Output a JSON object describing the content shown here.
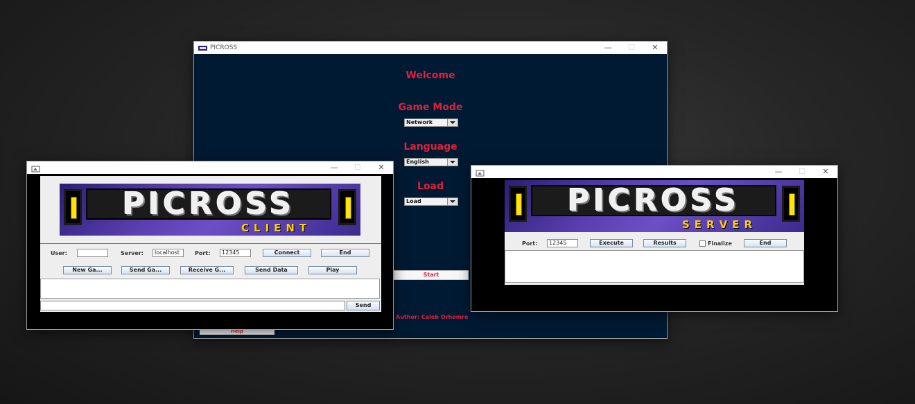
{
  "main_window": {
    "title": "PICROSS",
    "welcome": "Welcome",
    "game_mode_label": "Game Mode",
    "game_mode_value": "Network",
    "language_label": "Language",
    "language_value": "English",
    "load_label": "Load",
    "load_value": "Load",
    "start_label": "Start",
    "help_label": "Help",
    "author": "Author: Caleb Orhomre"
  },
  "client_window": {
    "banner_title": "PICROSS",
    "banner_sub": "CLIENT",
    "user_label": "User:",
    "user_value": "",
    "server_label": "Server:",
    "server_value": "localhost",
    "port_label": "Port:",
    "port_value": "12345",
    "connect_label": "Connect",
    "end_label": "End",
    "new_game_label": "New Ga...",
    "send_game_label": "Send Ga...",
    "receive_game_label": "Receive G...",
    "send_data_label": "Send Data",
    "play_label": "Play",
    "send_label": "Send",
    "chat_input_value": ""
  },
  "server_window": {
    "banner_title": "PICROSS",
    "banner_sub": "SERVER",
    "port_label": "Port:",
    "port_value": "12345",
    "execute_label": "Execute",
    "results_label": "Results",
    "finalize_label": "Finalize",
    "end_label": "End"
  },
  "window_controls": {
    "minimize": "—",
    "maximize": "☐",
    "close": "✕"
  },
  "colors": {
    "accent_red": "#e0213a",
    "main_bg": "#001a33",
    "banner_purple": "#5a3fb0",
    "banner_yellow": "#ffd000"
  }
}
